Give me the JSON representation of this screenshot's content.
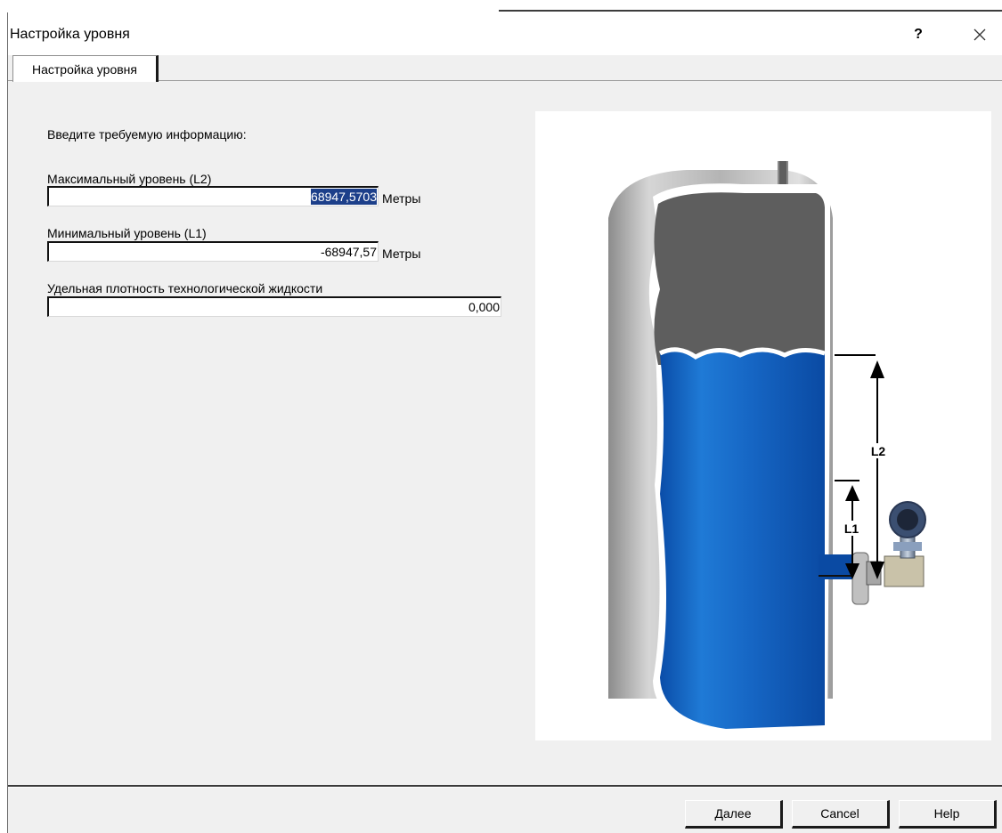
{
  "window": {
    "title": "Настройка уровня",
    "help_glyph": "?"
  },
  "tab": {
    "label": "Настройка уровня"
  },
  "form": {
    "instruction": "Введите требуемую информацию:",
    "max_level": {
      "label": "Максимальный уровень (L2)",
      "value": "68947,5703",
      "unit": "Метры"
    },
    "min_level": {
      "label": "Минимальный уровень (L1)",
      "value": "-68947,57",
      "unit": "Метры"
    },
    "density": {
      "label": "Удельная плотность технологической жидкости",
      "value": "0,000"
    }
  },
  "diagram": {
    "label_l2": "L2",
    "label_l1": "L1"
  },
  "buttons": {
    "next": "Далее",
    "cancel": "Cancel",
    "help": "Help"
  }
}
